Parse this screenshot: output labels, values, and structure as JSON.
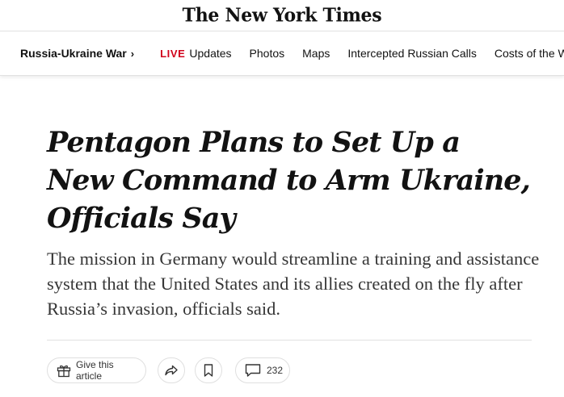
{
  "masthead": {
    "logo_text": "The New York Times"
  },
  "nav": {
    "section_label": "Russia-Ukraine War",
    "section_chevron": "›",
    "live_label": "LIVE",
    "updates_label": "Updates",
    "photos_label": "Photos",
    "maps_label": "Maps",
    "calls_label": "Intercepted Russian Calls",
    "costs_label": "Costs of the War"
  },
  "article": {
    "headline": "Pentagon Plans to Set Up a New Command to Arm Ukraine, Officials Say",
    "summary": "The mission in Germany would streamline a training and assistance system that the United States and its allies created on the fly after Russia’s invasion, officials said."
  },
  "actions": {
    "gift_label": "Give this article",
    "comment_count": "232",
    "icons": [
      "gift-icon",
      "share-icon",
      "bookmark-icon",
      "comment-icon"
    ]
  },
  "colors": {
    "live": "#d0021b",
    "text": "#121212",
    "summary": "#363636",
    "border": "#e2e2e2"
  }
}
